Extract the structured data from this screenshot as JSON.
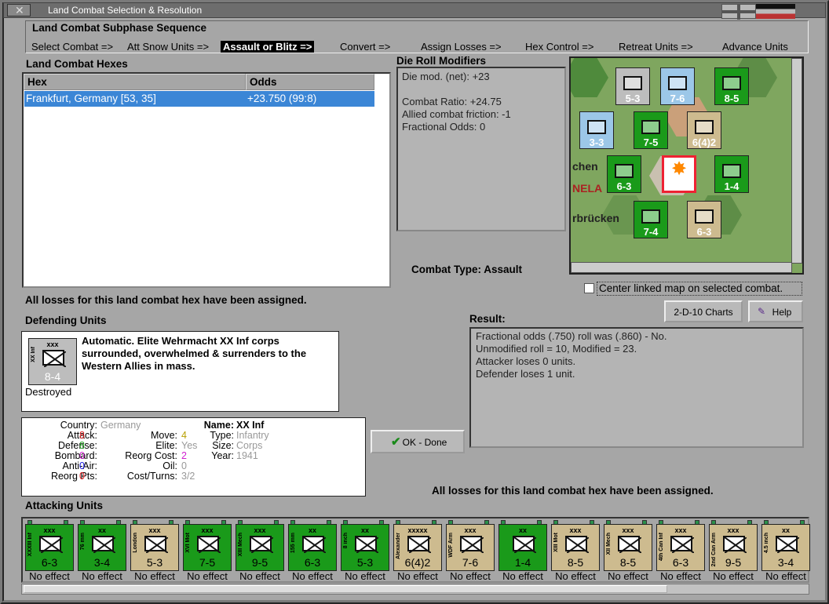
{
  "window": {
    "title": "Land Combat Selection & Resolution"
  },
  "subphase": {
    "heading": "Land Combat Subphase Sequence",
    "steps": [
      "Select Combat =>",
      "Att Snow Units =>",
      "Assault or Blitz =>",
      "Convert =>",
      "Assign Losses =>",
      "Hex Control =>",
      "Retreat Units =>",
      "Advance Units"
    ]
  },
  "hexes": {
    "heading": "Land Combat Hexes",
    "col_hex": "Hex",
    "col_odds": "Odds",
    "rows": [
      {
        "hex": "Frankfurt, Germany [53, 35]",
        "odds": "+23.750 (99:8)"
      }
    ]
  },
  "drm": {
    "heading": "Die Roll Modifiers",
    "lines": [
      "Die mod. (net): +23",
      "",
      "Combat Ratio: +24.75",
      "Allied combat friction: -1",
      "Fractional Odds: 0"
    ]
  },
  "combat_type": "Combat Type:  Assault",
  "center_map": "Center linked map on selected combat.",
  "losses_msg_top": "All losses for this land combat hex have been assigned.",
  "losses_msg_bottom": "All losses for this land combat hex have been assigned.",
  "buttons": {
    "charts": "2-D-10 Charts",
    "help": "Help",
    "ok": "OK - Done"
  },
  "result": {
    "heading": "Result:",
    "lines": [
      "Fractional odds (.750) roll was (.860)  - No.",
      "Unmodified roll = 10, Modified = 23.",
      "Attacker loses 0 units.",
      "Defender loses 1 unit."
    ]
  },
  "defending": {
    "heading": "Defending Units",
    "unit": {
      "size": "xxx",
      "name": "XX Inf",
      "strength": "8-4",
      "status": "Destroyed"
    },
    "text": "Automatic.  Elite Wehrmacht XX Inf corps surrounded, overwhelmed & surrenders to the Western Allies in mass."
  },
  "stats": {
    "country_l": "Country:",
    "country_v": "Germany",
    "attack_l": "Attack:",
    "attack_v": "8",
    "defense_l": "Defense:",
    "defense_v": "8",
    "bombard_l": "Bombard:",
    "bombard_v": "0",
    "antiair_l": "Anti-Air:",
    "antiair_v": "0",
    "reorgpts_l": "Reorg Pts:",
    "reorgpts_v": "0",
    "move_l": "Move:",
    "move_v": "4",
    "elite_l": "Elite:",
    "elite_v": "Yes",
    "reorgcost_l": "Reorg Cost:",
    "reorgcost_v": "2",
    "oil_l": "Oil:",
    "oil_v": "0",
    "costturns_l": "Cost/Turns:",
    "costturns_v": "3/2",
    "name_l": "Name:",
    "name_v": "XX Inf",
    "type_l": "Type:",
    "type_v": "Infantry",
    "size_l": "Size:",
    "size_v": "Corps",
    "year_l": "Year:",
    "year_v": "1941"
  },
  "attacking": {
    "heading": "Attacking Units",
    "units": [
      {
        "size": "xxx",
        "name": "XXXIII Inf",
        "strength": "6-3",
        "effect": "No effect",
        "color": "#1a9a1a"
      },
      {
        "size": "xx",
        "name": "76 mm",
        "strength": "3-4",
        "effect": "No effect",
        "color": "#1a9a1a"
      },
      {
        "size": "xxx",
        "name": "London",
        "strength": "5-3",
        "effect": "No effect",
        "color": "#cdbb8f"
      },
      {
        "size": "xxx",
        "name": "XVI Mot",
        "strength": "7-5",
        "effect": "No effect",
        "color": "#1a9a1a"
      },
      {
        "size": "xxx",
        "name": "XIII Mech",
        "strength": "9-5",
        "effect": "No effect",
        "color": "#1a9a1a"
      },
      {
        "size": "xx",
        "name": "155 mm",
        "strength": "6-3",
        "effect": "No effect",
        "color": "#1a9a1a"
      },
      {
        "size": "xx",
        "name": "8 inch",
        "strength": "5-3",
        "effect": "No effect",
        "color": "#1a9a1a"
      },
      {
        "size": "xxxxx",
        "name": "Alexander",
        "strength": "6(4)2",
        "effect": "No effect",
        "color": "#cdbb8f"
      },
      {
        "size": "xxx",
        "name": "WDF Arm",
        "strength": "7-6",
        "effect": "No effect",
        "color": "#cdbb8f"
      },
      {
        "size": "xx",
        "name": "",
        "strength": "1-4",
        "effect": "No effect",
        "color": "#1a9a1a"
      },
      {
        "size": "xxx",
        "name": "XIII Mot",
        "strength": "8-5",
        "effect": "No effect",
        "color": "#cdbb8f"
      },
      {
        "size": "xxx",
        "name": "XII Mech",
        "strength": "8-5",
        "effect": "No effect",
        "color": "#cdbb8f"
      },
      {
        "size": "xxx",
        "name": "4th Can Inf",
        "strength": "6-3",
        "effect": "No effect",
        "color": "#cdbb8f"
      },
      {
        "size": "xxx",
        "name": "2nd Can Arm",
        "strength": "9-5",
        "effect": "No effect",
        "color": "#cdbb8f"
      },
      {
        "size": "xx",
        "name": "4.5 inch",
        "strength": "3-4",
        "effect": "No effect",
        "color": "#cdbb8f"
      }
    ]
  },
  "map": {
    "counters": [
      {
        "s": "5-3",
        "c": "#bdbdbd"
      },
      {
        "s": "7-6",
        "c": "#9cc7e8"
      },
      {
        "s": "8-5",
        "c": "#1a9a1a"
      },
      {
        "s": "3-3",
        "c": "#9cc7e8"
      },
      {
        "s": "7-5",
        "c": "#1a9a1a"
      },
      {
        "s": "6(4)2",
        "c": "#cdbb8f"
      },
      {
        "s": "6-3",
        "c": "#1a9a1a"
      },
      {
        "s": "1-4",
        "c": "#1a9a1a"
      },
      {
        "s": "7-4",
        "c": "#1a9a1a"
      },
      {
        "s": "6-3",
        "c": "#cdbb8f"
      }
    ],
    "labels": [
      "chen",
      "NELA",
      "rbrücken"
    ]
  }
}
